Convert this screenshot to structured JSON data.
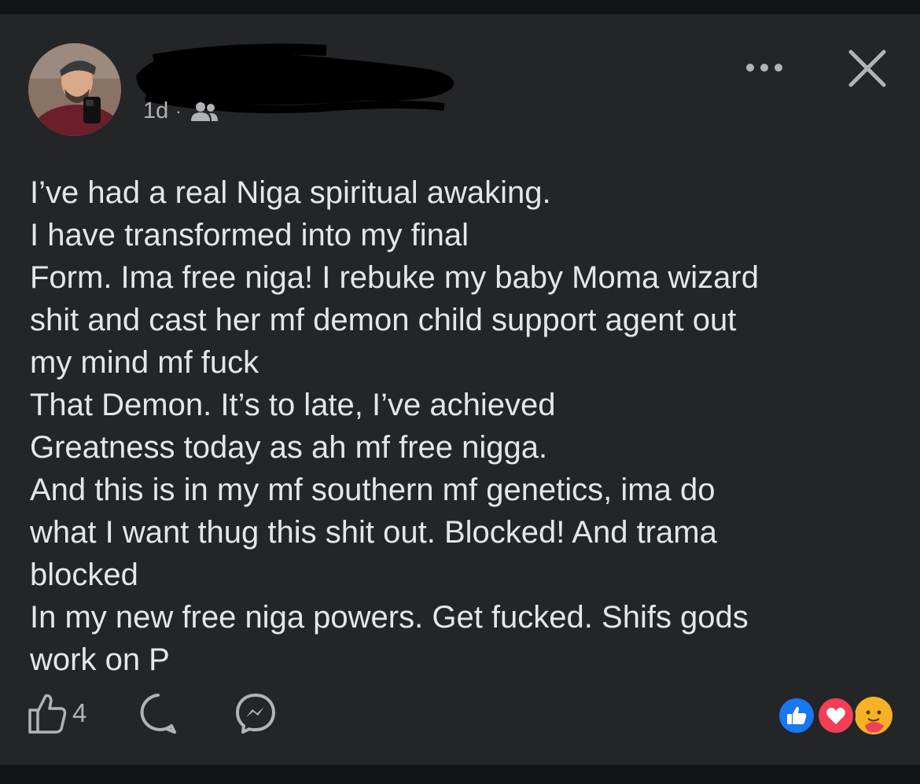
{
  "post": {
    "author_name_redacted": true,
    "timestamp": "1d",
    "separator": "·",
    "audience_icon": "group-audience-icon",
    "text_lines": [
      "I’ve had a real Niga spiritual awaking.",
      "I have transformed into my final",
      "Form. Ima free niga! I rebuke my baby Moma wizard",
      "shit and cast her mf demon child support agent out",
      "my mind mf fuck",
      "That Demon. It’s to late, I’ve achieved",
      "Greatness today as ah mf free nigga.",
      "And this is in my mf southern mf genetics, ima do",
      "what I want thug this shit out. Blocked! And trama",
      "blocked",
      "In my new free niga powers. Get fucked. Shifs gods",
      "work on P"
    ]
  },
  "header_icons": [
    "more-options-icon",
    "close-icon"
  ],
  "actions": {
    "like_count": "4",
    "icons": [
      "like-icon",
      "comment-icon",
      "messenger-share-icon"
    ]
  },
  "reactions": [
    "like-reaction",
    "love-reaction",
    "care-reaction"
  ],
  "colors": {
    "background": "#242526",
    "text": "#e4e6eb",
    "secondary_text": "#b0b3b8",
    "like_blue": "#1877f2",
    "love_red": "#f33e58",
    "care_yellow": "#f7b125"
  }
}
